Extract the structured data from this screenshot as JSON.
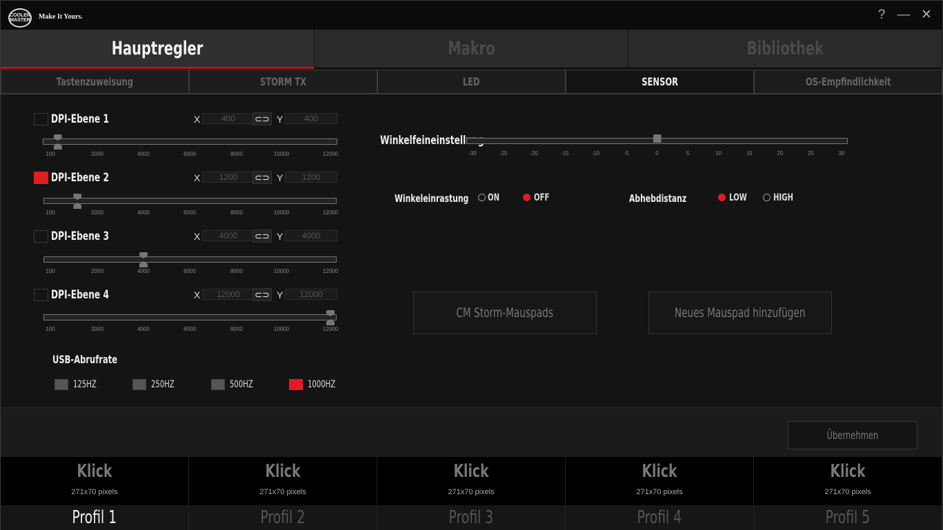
{
  "titlebar": {
    "logo": "COOLER MASTER",
    "tagline": "Make It Yours.",
    "help": "?",
    "minimize": "—",
    "close": "✕"
  },
  "main_tabs": [
    {
      "label": "Hauptregler",
      "active": true
    },
    {
      "label": "Makro",
      "active": false
    },
    {
      "label": "Bibliothek",
      "active": false
    }
  ],
  "sub_tabs": [
    {
      "label": "Tastenzuweisung",
      "active": false
    },
    {
      "label": "STORM TX",
      "active": false
    },
    {
      "label": "LED",
      "active": false
    },
    {
      "label": "SENSOR",
      "active": true
    },
    {
      "label": "OS-Empfindlichkeit",
      "active": false
    }
  ],
  "dpi": {
    "x_label": "X",
    "y_label": "Y",
    "tick_labels": [
      "100",
      "2000",
      "4000",
      "6000",
      "8000",
      "10000",
      "12000"
    ],
    "levels": [
      {
        "label": "DPI-Ebene 1",
        "checked": false,
        "x": "400",
        "y": "400",
        "value": 400
      },
      {
        "label": "DPI-Ebene 2",
        "checked": true,
        "x": "1200",
        "y": "1200",
        "value": 1200
      },
      {
        "label": "DPI-Ebene 3",
        "checked": false,
        "x": "4000",
        "y": "4000",
        "value": 4000
      },
      {
        "label": "DPI-Ebene 4",
        "checked": false,
        "x": "12000",
        "y": "12000",
        "value": 12000
      }
    ]
  },
  "usb": {
    "label": "USB-Abrufrate",
    "options": [
      {
        "label": "125HZ",
        "selected": false
      },
      {
        "label": "250HZ",
        "selected": false
      },
      {
        "label": "500HZ",
        "selected": false
      },
      {
        "label": "1000HZ",
        "selected": true
      }
    ]
  },
  "angle": {
    "label": "Winkelfeineinstellung",
    "value": 0,
    "ticks": [
      "-30",
      "-25",
      "-20",
      "-15",
      "-10",
      "-5",
      "0",
      "5",
      "10",
      "15",
      "20",
      "25",
      "30"
    ]
  },
  "snap": {
    "label": "Winkeleinrastung",
    "on_label": "ON",
    "off_label": "OFF",
    "selected": "OFF"
  },
  "lift": {
    "label": "Abhebdistanz",
    "low_label": "LOW",
    "high_label": "HIGH",
    "selected": "LOW"
  },
  "buttons": {
    "cm_pads": "CM Storm-Mauspads",
    "add_pad": "Neues Mauspad hinzufügen",
    "apply": "Übernehmen"
  },
  "profiles": [
    {
      "image_text": "Klick",
      "image_size": "271x70 pixels",
      "name": "Profil 1",
      "active": true
    },
    {
      "image_text": "Klick",
      "image_size": "271x70 pixels",
      "name": "Profil 2",
      "active": false
    },
    {
      "image_text": "Klick",
      "image_size": "271x70 pixels",
      "name": "Profil 3",
      "active": false
    },
    {
      "image_text": "Klick",
      "image_size": "271x70 pixels",
      "name": "Profil 4",
      "active": false
    },
    {
      "image_text": "Klick",
      "image_size": "271x70 pixels",
      "name": "Profil 5",
      "active": false
    }
  ],
  "colors": {
    "accent": "#e31b23",
    "background": "#141414"
  }
}
